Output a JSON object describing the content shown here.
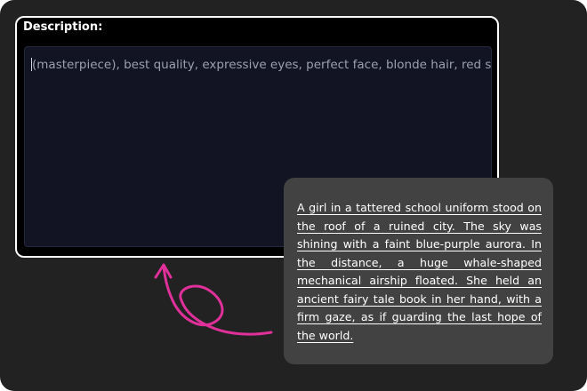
{
  "description_panel": {
    "label": "Description:",
    "prompt_value": "(masterpiece), best quality, expressive eyes, perfect face, blonde hair, red skirt"
  },
  "callout": {
    "text": "A girl in a tattered school uniform stood on the roof of a ruined city. The sky was shining with a faint blue-purple aurora. In the distance, a huge whale-shaped mechanical airship floated. She held an ancient fairy tale book in her hand, with a firm gaze, as if guarding the last hope of the world."
  },
  "colors": {
    "background": "#222222",
    "panel": "#000000",
    "input_bg": "#121424",
    "callout_bg": "#424242",
    "arrow": "#e0309a",
    "text": "#ffffff"
  },
  "icons": {
    "annotation": "curly-arrow-icon"
  }
}
